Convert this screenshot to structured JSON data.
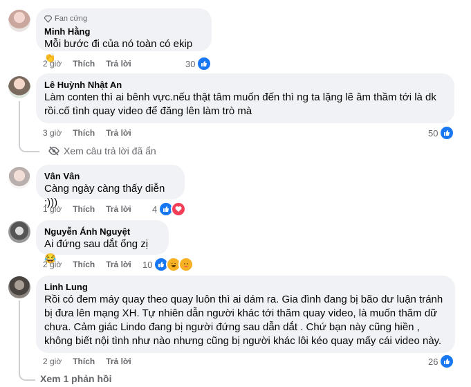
{
  "comments": [
    {
      "badge": "Fan cứng",
      "author": "Minh Hằng",
      "text": "Mỗi bước đi của nó toàn có ekip",
      "emoji": "👏",
      "time": "2 giờ",
      "like_label": "Thích",
      "reply_label": "Trả lời",
      "reaction_count": "30",
      "reaction_icons": [
        "like-icon"
      ]
    },
    {
      "author": "Lê Huỳnh Nhật An",
      "text": "Làm conten thì ai bênh vực.nếu thật tâm muốn đến thì ng ta lặng lẽ âm thầm tới là dk rồi.cố tình quay video để đăng lên làm trò mà",
      "time": "3 giờ",
      "like_label": "Thích",
      "reply_label": "Trả lời",
      "reaction_count": "50",
      "reaction_icons": [
        "like-icon"
      ]
    },
    {
      "author": "Vân Vân",
      "text": "Càng ngày càng thấy diễn :)))",
      "time": "1 giờ",
      "like_label": "Thích",
      "reply_label": "Trả lời",
      "reaction_count": "4",
      "reaction_icons": [
        "like-icon",
        "heart-icon"
      ]
    },
    {
      "author": "Nguyễn Ánh Nguyệt",
      "text": "Ai đứng sau dắt ổng zị",
      "emoji": "😂",
      "time": "2 giờ",
      "like_label": "Thích",
      "reply_label": "Trả lời",
      "reaction_count": "10",
      "reaction_icons": [
        "like-icon",
        "haha-icon",
        "care-icon"
      ]
    },
    {
      "author": "Linh Lung",
      "text": "Rồi có đem máy quay theo quay luôn thì ai dám ra. Gia đình đang bị bão dư luận tránh bị đưa lên mạng XH. Tự nhiên dẫn người khác tới thăm quay video, là muốn thăm dữ chưa. Cảm giác Lindo đang bị người đứng sau dẫn dắt . Chứ bạn này cũng hiền , không biết nội tình như nào nhưng cũng bị người khác lôi kéo quay mấy cái video này.",
      "time": "2 giờ",
      "like_label": "Thích",
      "reply_label": "Trả lời",
      "reaction_count": "26",
      "reaction_icons": [
        "like-icon"
      ]
    }
  ],
  "hidden_replies_label": "Xem câu trả lời đã ẩn",
  "view_replies_label": "Xem 1 phản hồi",
  "colors": {
    "like": "#1877f2",
    "heart": "#f33e58",
    "care": "#f7b125",
    "bubble": "#f0f2f5",
    "meta": "#65676b"
  }
}
